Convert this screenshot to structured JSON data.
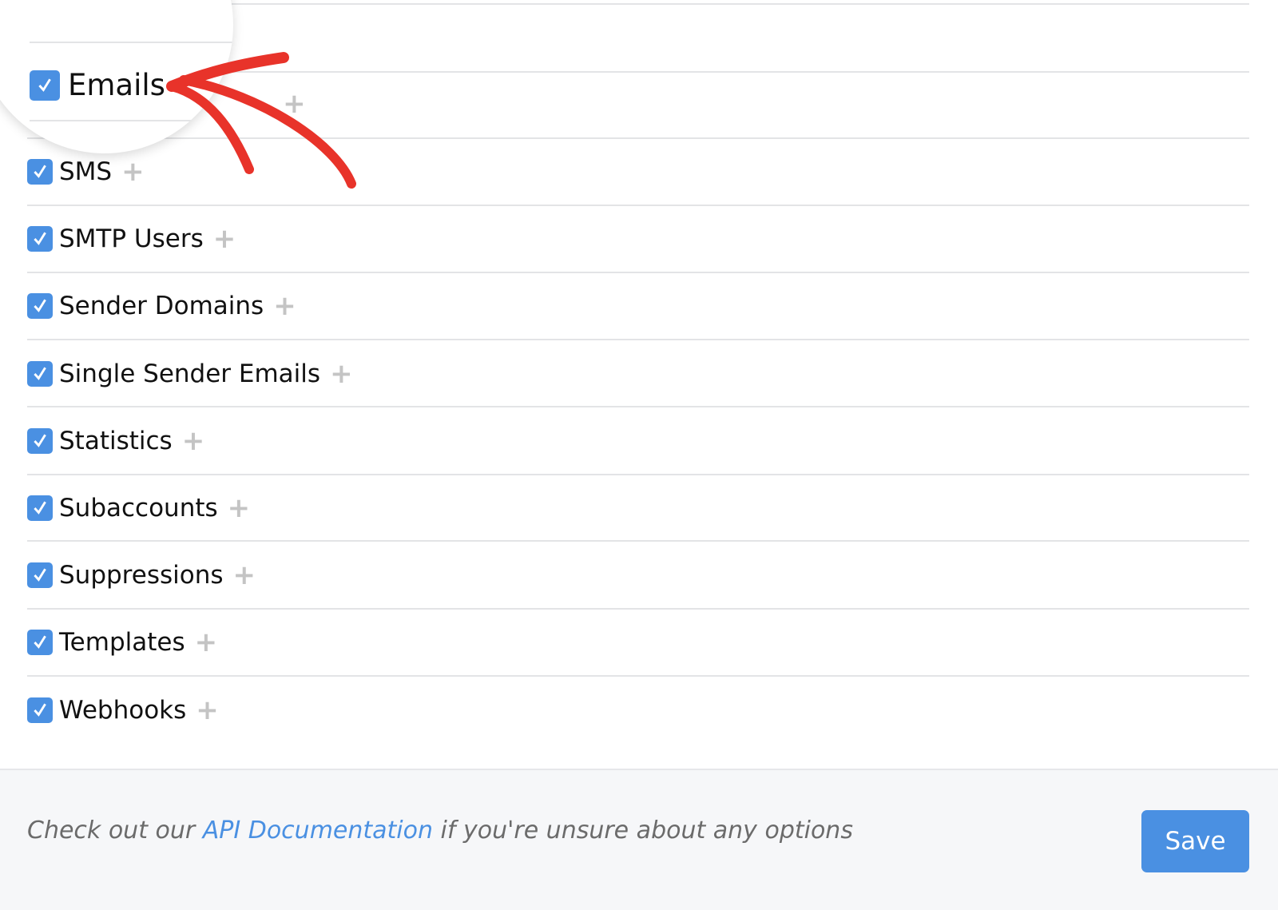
{
  "permissions": [
    {
      "label": "Emails",
      "checked": true
    },
    {
      "label": "SMS",
      "checked": true
    },
    {
      "label": "SMTP Users",
      "checked": true
    },
    {
      "label": "Sender Domains",
      "checked": true
    },
    {
      "label": "Single Sender Emails",
      "checked": true
    },
    {
      "label": "Statistics",
      "checked": true
    },
    {
      "label": "Subaccounts",
      "checked": true
    },
    {
      "label": "Suppressions",
      "checked": true
    },
    {
      "label": "Templates",
      "checked": true
    },
    {
      "label": "Webhooks",
      "checked": true
    }
  ],
  "footer": {
    "note_before": "Check out our ",
    "link": "API Documentation",
    "note_after": " if you're unsure about any options",
    "save_label": "Save"
  },
  "colors": {
    "accent": "#4a90e2",
    "annotation": "#e8332a"
  },
  "icons": {
    "checkbox": "checkbox-checked-icon",
    "expand": "plus-icon"
  }
}
